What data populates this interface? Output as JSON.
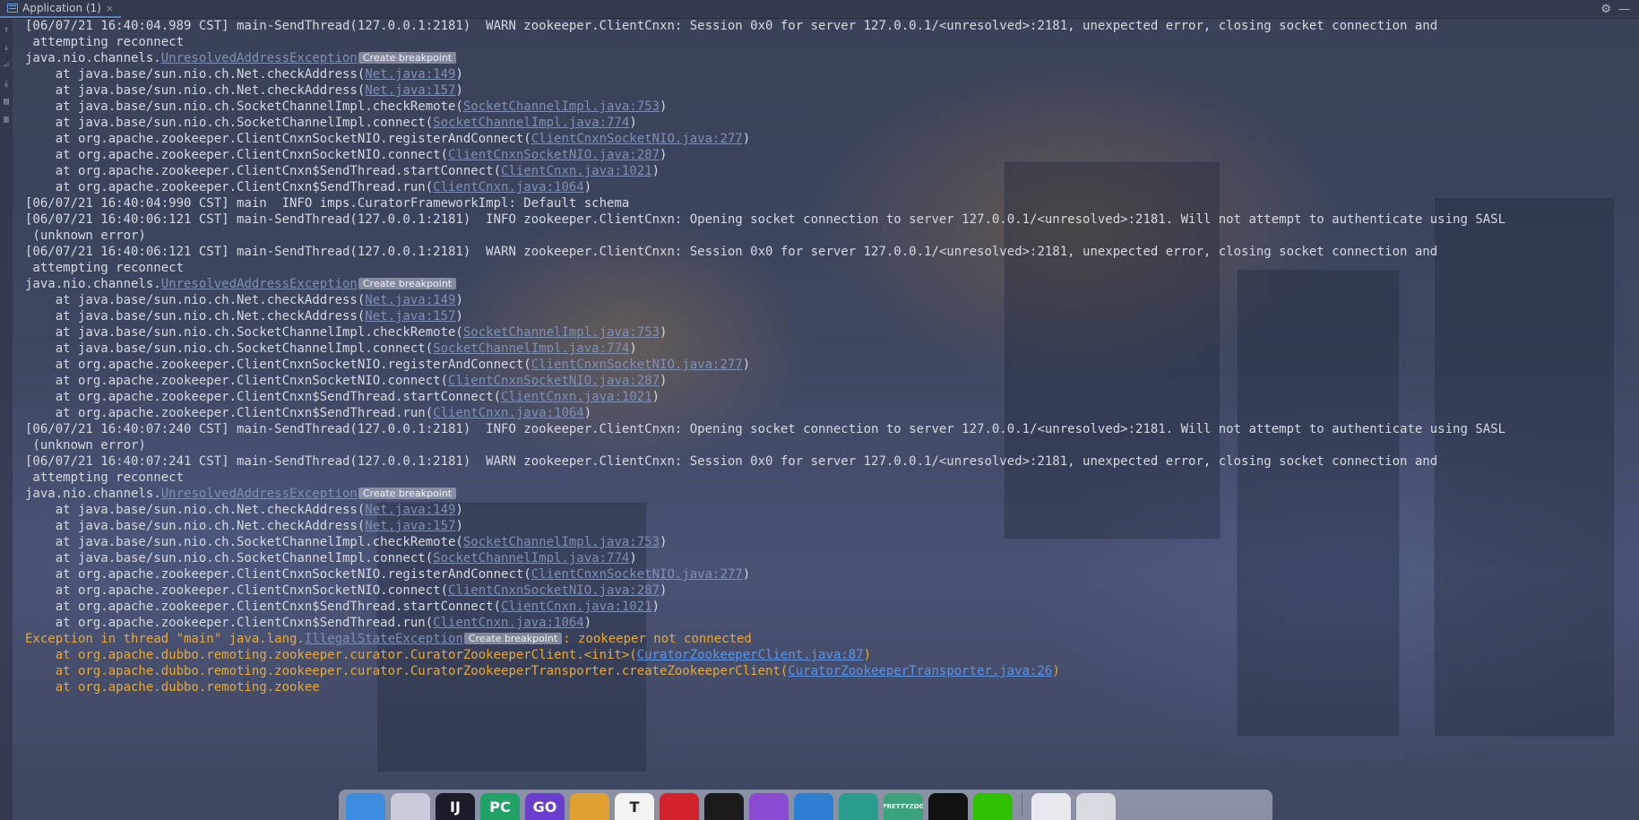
{
  "tab_bar": {
    "tab_title": "Application (1)",
    "close_glyph": "×"
  },
  "settings": {
    "gear_glyph": "⚙",
    "minimize_glyph": "—"
  },
  "breakpoint_label": "Create breakpoint",
  "console_lines": [
    {
      "type": "text",
      "text": "[06/07/21 16:40:04.989 CST] main-SendThread(127.0.0.1:2181)  WARN zookeeper.ClientCnxn: Session 0x0 for server 127.0.0.1/<unresolved>:2181, unexpected error, closing socket connection and"
    },
    {
      "type": "text",
      "text": " attempting reconnect"
    },
    {
      "type": "exception",
      "prefix": "java.nio.channels.",
      "link": "UnresolvedAddressException"
    },
    {
      "type": "stack",
      "prefix": "    at java.base/sun.nio.ch.Net.checkAddress(",
      "link": "Net.java:149",
      "suffix": ")"
    },
    {
      "type": "stack",
      "prefix": "    at java.base/sun.nio.ch.Net.checkAddress(",
      "link": "Net.java:157",
      "suffix": ")"
    },
    {
      "type": "stack",
      "prefix": "    at java.base/sun.nio.ch.SocketChannelImpl.checkRemote(",
      "link": "SocketChannelImpl.java:753",
      "suffix": ")"
    },
    {
      "type": "stack",
      "prefix": "    at java.base/sun.nio.ch.SocketChannelImpl.connect(",
      "link": "SocketChannelImpl.java:774",
      "suffix": ")"
    },
    {
      "type": "stack",
      "prefix": "    at org.apache.zookeeper.ClientCnxnSocketNIO.registerAndConnect(",
      "link": "ClientCnxnSocketNIO.java:277",
      "suffix": ")"
    },
    {
      "type": "stack",
      "prefix": "    at org.apache.zookeeper.ClientCnxnSocketNIO.connect(",
      "link": "ClientCnxnSocketNIO.java:287",
      "suffix": ")"
    },
    {
      "type": "stack",
      "prefix": "    at org.apache.zookeeper.ClientCnxn$SendThread.startConnect(",
      "link": "ClientCnxn.java:1021",
      "suffix": ")"
    },
    {
      "type": "stack",
      "prefix": "    at org.apache.zookeeper.ClientCnxn$SendThread.run(",
      "link": "ClientCnxn.java:1064",
      "suffix": ")"
    },
    {
      "type": "text",
      "text": "[06/07/21 16:40:04:990 CST] main  INFO imps.CuratorFrameworkImpl: Default schema"
    },
    {
      "type": "text",
      "text": "[06/07/21 16:40:06:121 CST] main-SendThread(127.0.0.1:2181)  INFO zookeeper.ClientCnxn: Opening socket connection to server 127.0.0.1/<unresolved>:2181. Will not attempt to authenticate using SASL"
    },
    {
      "type": "text",
      "text": " (unknown error)"
    },
    {
      "type": "text",
      "text": "[06/07/21 16:40:06:121 CST] main-SendThread(127.0.0.1:2181)  WARN zookeeper.ClientCnxn: Session 0x0 for server 127.0.0.1/<unresolved>:2181, unexpected error, closing socket connection and"
    },
    {
      "type": "text",
      "text": " attempting reconnect"
    },
    {
      "type": "exception",
      "prefix": "java.nio.channels.",
      "link": "UnresolvedAddressException"
    },
    {
      "type": "stack",
      "prefix": "    at java.base/sun.nio.ch.Net.checkAddress(",
      "link": "Net.java:149",
      "suffix": ")"
    },
    {
      "type": "stack",
      "prefix": "    at java.base/sun.nio.ch.Net.checkAddress(",
      "link": "Net.java:157",
      "suffix": ")"
    },
    {
      "type": "stack",
      "prefix": "    at java.base/sun.nio.ch.SocketChannelImpl.checkRemote(",
      "link": "SocketChannelImpl.java:753",
      "suffix": ")"
    },
    {
      "type": "stack",
      "prefix": "    at java.base/sun.nio.ch.SocketChannelImpl.connect(",
      "link": "SocketChannelImpl.java:774",
      "suffix": ")"
    },
    {
      "type": "stack",
      "prefix": "    at org.apache.zookeeper.ClientCnxnSocketNIO.registerAndConnect(",
      "link": "ClientCnxnSocketNIO.java:277",
      "suffix": ")"
    },
    {
      "type": "stack",
      "prefix": "    at org.apache.zookeeper.ClientCnxnSocketNIO.connect(",
      "link": "ClientCnxnSocketNIO.java:287",
      "suffix": ")"
    },
    {
      "type": "stack",
      "prefix": "    at org.apache.zookeeper.ClientCnxn$SendThread.startConnect(",
      "link": "ClientCnxn.java:1021",
      "suffix": ")"
    },
    {
      "type": "stack",
      "prefix": "    at org.apache.zookeeper.ClientCnxn$SendThread.run(",
      "link": "ClientCnxn.java:1064",
      "suffix": ")"
    },
    {
      "type": "text",
      "text": "[06/07/21 16:40:07:240 CST] main-SendThread(127.0.0.1:2181)  INFO zookeeper.ClientCnxn: Opening socket connection to server 127.0.0.1/<unresolved>:2181. Will not attempt to authenticate using SASL"
    },
    {
      "type": "text",
      "text": " (unknown error)"
    },
    {
      "type": "text",
      "text": "[06/07/21 16:40:07:241 CST] main-SendThread(127.0.0.1:2181)  WARN zookeeper.ClientCnxn: Session 0x0 for server 127.0.0.1/<unresolved>:2181, unexpected error, closing socket connection and"
    },
    {
      "type": "text",
      "text": " attempting reconnect"
    },
    {
      "type": "exception",
      "prefix": "java.nio.channels.",
      "link": "UnresolvedAddressException"
    },
    {
      "type": "stack",
      "prefix": "    at java.base/sun.nio.ch.Net.checkAddress(",
      "link": "Net.java:149",
      "suffix": ")"
    },
    {
      "type": "stack",
      "prefix": "    at java.base/sun.nio.ch.Net.checkAddress(",
      "link": "Net.java:157",
      "suffix": ")"
    },
    {
      "type": "stack",
      "prefix": "    at java.base/sun.nio.ch.SocketChannelImpl.checkRemote(",
      "link": "SocketChannelImpl.java:753",
      "suffix": ")"
    },
    {
      "type": "stack",
      "prefix": "    at java.base/sun.nio.ch.SocketChannelImpl.connect(",
      "link": "SocketChannelImpl.java:774",
      "suffix": ")"
    },
    {
      "type": "stack",
      "prefix": "    at org.apache.zookeeper.ClientCnxnSocketNIO.registerAndConnect(",
      "link": "ClientCnxnSocketNIO.java:277",
      "suffix": ")"
    },
    {
      "type": "stack",
      "prefix": "    at org.apache.zookeeper.ClientCnxnSocketNIO.connect(",
      "link": "ClientCnxnSocketNIO.java:287",
      "suffix": ")"
    },
    {
      "type": "stack",
      "prefix": "    at org.apache.zookeeper.ClientCnxn$SendThread.startConnect(",
      "link": "ClientCnxn.java:1021",
      "suffix": ")"
    },
    {
      "type": "stack",
      "prefix": "    at org.apache.zookeeper.ClientCnxn$SendThread.run(",
      "link": "ClientCnxn.java:1064",
      "suffix": ")"
    },
    {
      "type": "error_exception",
      "prefix": "Exception in thread \"main\" java.lang.",
      "link": "IllegalStateException",
      "suffix": ": zookeeper not connected"
    },
    {
      "type": "error_stack",
      "prefix": "    at org.apache.dubbo.remoting.zookeeper.curator.CuratorZookeeperClient.<init>(",
      "link": "CuratorZookeeperClient.java:87",
      "suffix": ")"
    },
    {
      "type": "error_stack",
      "prefix": "    at org.apache.dubbo.remoting.zookeeper.curator.CuratorZookeeperTransporter.createZookeeperClient(",
      "link": "CuratorZookeeperTransporter.java:26",
      "suffix": ")"
    },
    {
      "type": "error_text",
      "text": "    at org.apache.dubbo.remoting.zookee"
    }
  ],
  "dock": {
    "apps": [
      {
        "name": "finder",
        "label": "",
        "color": "#3b8de0"
      },
      {
        "name": "launchpad",
        "label": "",
        "color": "#c8ccd8"
      },
      {
        "name": "intellij",
        "label": "IJ",
        "color": "#1b1b2a"
      },
      {
        "name": "pycharm",
        "label": "PC",
        "color": "#21a366"
      },
      {
        "name": "goland",
        "label": "GO",
        "color": "#6a3fd0"
      },
      {
        "name": "chrome",
        "label": "",
        "color": "#e0a030"
      },
      {
        "name": "typora",
        "label": "T",
        "color": "#f2f2f2"
      },
      {
        "name": "netease-music",
        "label": "",
        "color": "#d2232a"
      },
      {
        "name": "qq",
        "label": "",
        "color": "#1a1a1a"
      },
      {
        "name": "visual-studio",
        "label": "",
        "color": "#8a4bd2"
      },
      {
        "name": "vscode",
        "label": "",
        "color": "#2d7fd3"
      },
      {
        "name": "vscode-insiders",
        "label": "",
        "color": "#2a9d8f"
      },
      {
        "name": "prettyzoo",
        "label": "PRETTYZOO",
        "color": "#3aa37a"
      },
      {
        "name": "terminal",
        "label": "",
        "color": "#111111"
      },
      {
        "name": "wechat",
        "label": "",
        "color": "#2dc100"
      }
    ],
    "recent": [
      {
        "name": "recent-window",
        "label": "",
        "color": "#e8e8ee"
      },
      {
        "name": "trash",
        "label": "",
        "color": "#d8dbe2"
      }
    ]
  }
}
